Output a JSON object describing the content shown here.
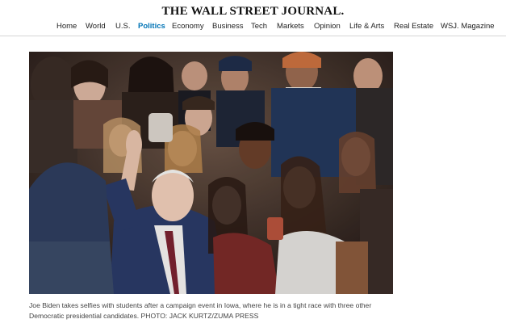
{
  "header": {
    "masthead": "THE WALL STREET JOURNAL."
  },
  "nav": {
    "items": [
      {
        "label": "Home"
      },
      {
        "label": "World"
      },
      {
        "label": "U.S."
      },
      {
        "label": "Politics",
        "active": true
      },
      {
        "label": "Economy"
      },
      {
        "label": "Business"
      },
      {
        "label": "Tech"
      },
      {
        "label": "Markets"
      },
      {
        "label": "Opinion"
      },
      {
        "label": "Life & Arts"
      },
      {
        "label": "Real Estate"
      },
      {
        "label": "WSJ. Magazine"
      }
    ],
    "active_color": "#0274b6"
  },
  "photo": {
    "caption": "Joe Biden takes selfies with students after a campaign event in Iowa, where he is in a tight race with three other Democratic presidential candidates.",
    "credit": "PHOTO: JACK KURTZ/ZUMA PRESS"
  }
}
